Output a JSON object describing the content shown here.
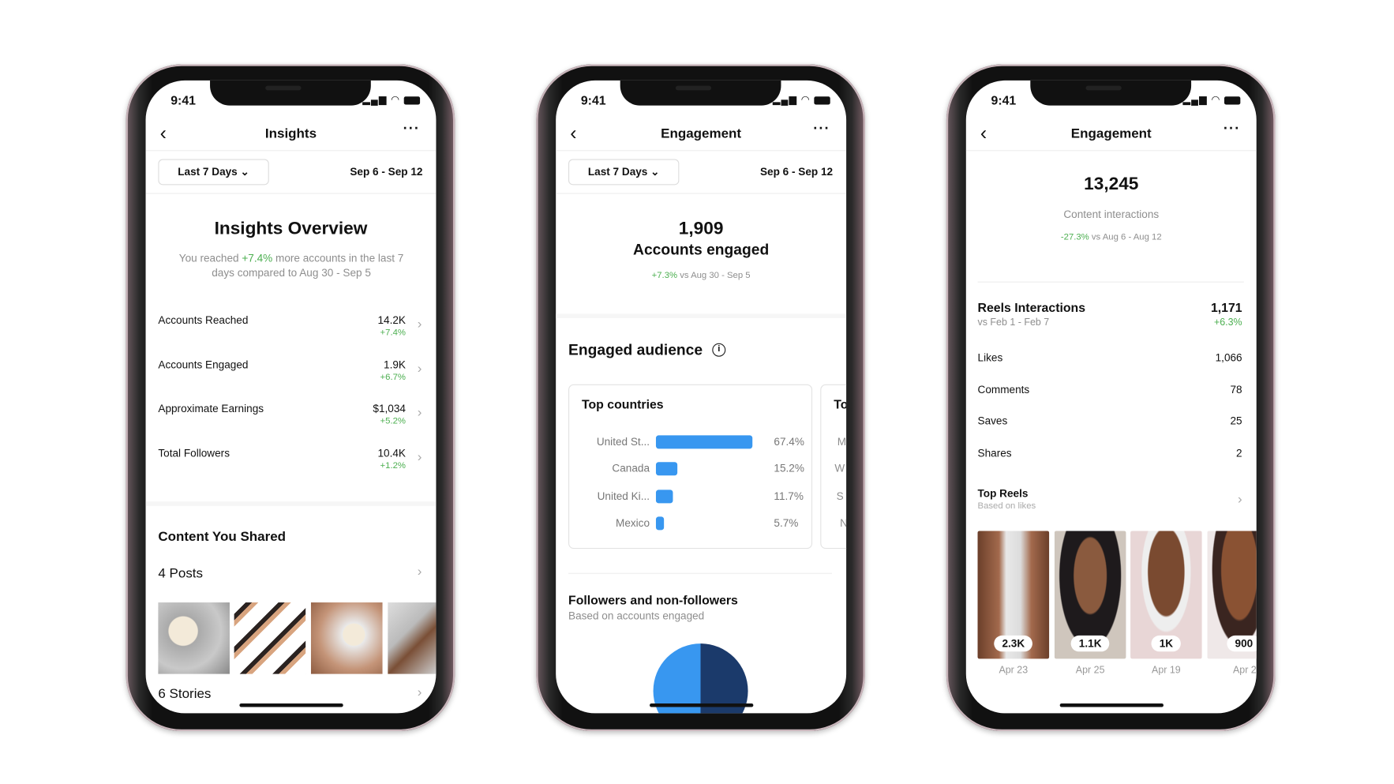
{
  "status_time": "9:41",
  "status_icons": [
    "signal-icon",
    "wifi-icon",
    "battery-icon"
  ],
  "colors": {
    "accent_blue": "#3897f0",
    "navy": "#1b3a6b",
    "positive_green": "#4caf50"
  },
  "phone1": {
    "title": "Insights",
    "range_dropdown": "Last 7 Days",
    "date_range": "Sep 6 - Sep 12",
    "overview_title": "Insights Overview",
    "overview_pre": "You reached ",
    "overview_delta": "+7.4%",
    "overview_post": " more accounts in the last 7 days compared to Aug 30 - Sep 5",
    "metrics": [
      {
        "label": "Accounts Reached",
        "value": "14.2K",
        "delta": "+7.4%"
      },
      {
        "label": "Accounts Engaged",
        "value": "1.9K",
        "delta": "+6.7%"
      },
      {
        "label": "Approximate Earnings",
        "value": "$1,034",
        "delta": "+5.2%"
      },
      {
        "label": "Total Followers",
        "value": "10.4K",
        "delta": "+1.2%"
      }
    ],
    "content_title": "Content You Shared",
    "posts_label": "4 Posts",
    "stories_label": "6 Stories"
  },
  "phone2": {
    "title": "Engagement",
    "range_dropdown": "Last 7 Days",
    "date_range": "Sep 6 - Sep 12",
    "count": "1,909",
    "count_label": "Accounts engaged",
    "delta": "+7.3%",
    "delta_compare": " vs Aug 30 - Sep 5",
    "audience_title": "Engaged audience",
    "top_countries_title": "Top countries",
    "countries": [
      {
        "label": "United St...",
        "pct_text": "67.4%",
        "pct": 67.4
      },
      {
        "label": "Canada",
        "pct_text": "15.2%",
        "pct": 15.2
      },
      {
        "label": "United Ki...",
        "pct_text": "11.7%",
        "pct": 11.7
      },
      {
        "label": "Mexico",
        "pct_text": "5.7%",
        "pct": 5.7
      }
    ],
    "next_card_title": "To",
    "next_card_rows": [
      "M",
      "W",
      "S",
      "N"
    ],
    "followers_title": "Followers and non-followers",
    "followers_subtitle": "Based on accounts engaged"
  },
  "phone3": {
    "title": "Engagement",
    "count": "13,245",
    "count_label": "Content interactions",
    "delta": "-27.3%",
    "delta_compare": " vs Aug 6 - Aug 12",
    "reels_title": "Reels Interactions",
    "reels_compare": "vs Feb 1 - Feb 7",
    "reels_value": "1,171",
    "reels_delta": "+6.3%",
    "breakdown": [
      {
        "label": "Likes",
        "value": "1,066"
      },
      {
        "label": "Comments",
        "value": "78"
      },
      {
        "label": "Saves",
        "value": "25"
      },
      {
        "label": "Shares",
        "value": "2"
      }
    ],
    "top_reels_title": "Top Reels",
    "top_reels_subtitle": "Based on likes",
    "reels": [
      {
        "likes": "2.3K",
        "date": "Apr 23"
      },
      {
        "likes": "1.1K",
        "date": "Apr 25"
      },
      {
        "likes": "1K",
        "date": "Apr 19"
      },
      {
        "likes": "900",
        "date": "Apr 2"
      }
    ]
  }
}
